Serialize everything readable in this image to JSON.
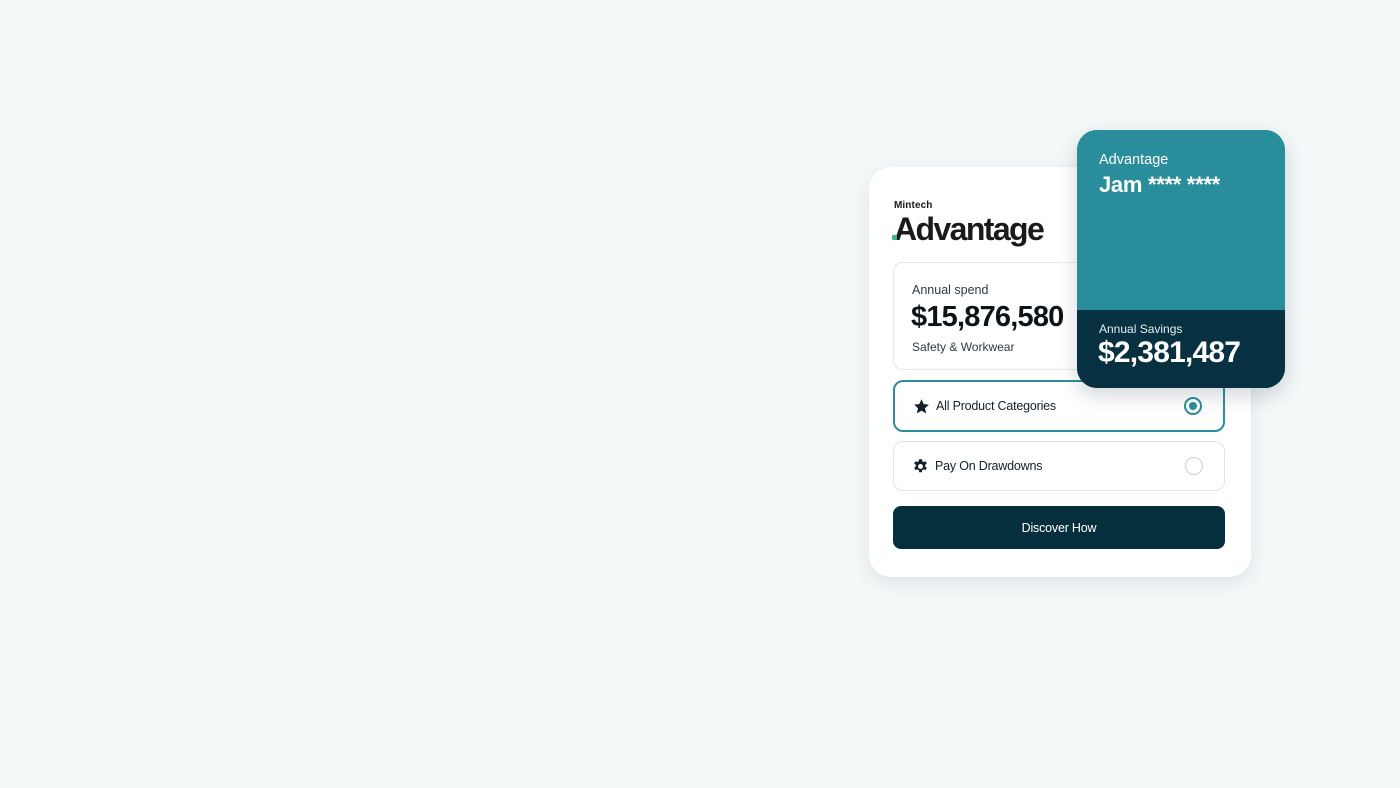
{
  "brand": {
    "company": "Mintech",
    "product": "Advantage",
    "dot_color": "#3cb878"
  },
  "spend": {
    "label": "Annual spend",
    "value": "$15,876,580",
    "category": "Safety & Workwear"
  },
  "options": [
    {
      "label": "All Product Categories",
      "icon": "star-icon",
      "selected": true
    },
    {
      "label": "Pay On Drawdowns",
      "icon": "gear-icon",
      "selected": false
    }
  ],
  "cta": {
    "label": "Discover How"
  },
  "card": {
    "brand": "Advantage",
    "holder": "Jam **** ****",
    "savings_label": "Annual Savings",
    "savings_value": "$2,381,487"
  },
  "colors": {
    "background": "#f4f8f9",
    "accent": "#2b8d9c",
    "dark": "#052f3d"
  }
}
